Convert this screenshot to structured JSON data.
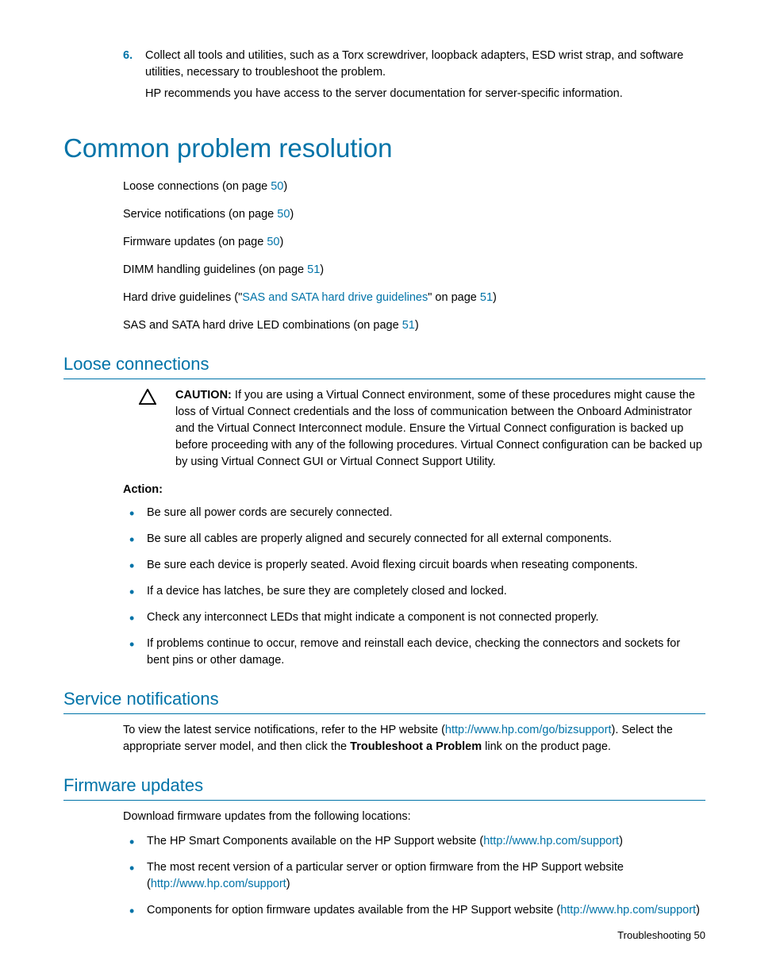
{
  "step6": {
    "num": "6.",
    "p1": "Collect all tools and utilities, such as a Torx screwdriver, loopback adapters, ESD wrist strap, and software utilities, necessary to troubleshoot the problem.",
    "p2": "HP recommends you have access to the server documentation for server-specific information."
  },
  "h1": "Common problem resolution",
  "toc": {
    "l1a": "Loose connections (on page ",
    "l1p": "50",
    "l1b": ")",
    "l2a": "Service notifications (on page ",
    "l2p": "50",
    "l2b": ")",
    "l3a": "Firmware updates (on page ",
    "l3p": "50",
    "l3b": ")",
    "l4a": "DIMM handling guidelines (on page ",
    "l4p": "51",
    "l4b": ")",
    "l5a": "Hard drive guidelines (\"",
    "l5link": "SAS and SATA hard drive guidelines",
    "l5b": "\" on page ",
    "l5p": "51",
    "l5c": ")",
    "l6a": "SAS and SATA hard drive LED combinations (on page ",
    "l6p": "51",
    "l6b": ")"
  },
  "loose": {
    "heading": "Loose connections",
    "caution_label": "CAUTION:",
    "caution_text": "   If you are using a Virtual Connect environment, some of these procedures might cause the loss of Virtual Connect credentials and the loss of communication between the Onboard Administrator and the Virtual Connect Interconnect module. Ensure the Virtual Connect configuration is backed up before proceeding with any of the following procedures. Virtual Connect configuration can be backed up by using Virtual Connect GUI or Virtual Connect Support Utility.",
    "action_label": "Action",
    "action_colon": ":",
    "b1": "Be sure all power cords are securely connected.",
    "b2": "Be sure all cables are properly aligned and securely connected for all external components.",
    "b3": "Be sure each device is properly seated. Avoid flexing circuit boards when reseating components.",
    "b4": "If a device has latches, be sure they are completely closed and locked.",
    "b5": "Check any interconnect LEDs that might indicate a component is not connected properly.",
    "b6": "If problems continue to occur, remove and reinstall each device, checking the connectors and sockets for bent pins or other damage."
  },
  "service": {
    "heading": "Service notifications",
    "p_a": "To view the latest service notifications, refer to the HP website (",
    "link": "http://www.hp.com/go/bizsupport",
    "p_b": "). Select the appropriate server model, and then click the ",
    "bold": "Troubleshoot a Problem",
    "p_c": " link on the product page."
  },
  "firmware": {
    "heading": "Firmware updates",
    "intro": "Download firmware updates from the following locations:",
    "b1a": "The HP Smart Components available on the HP Support website (",
    "b1link": "http://www.hp.com/support",
    "b1b": ")",
    "b2a": "The most recent version of a particular server or option firmware from the HP Support website (",
    "b2link": "http://www.hp.com/support",
    "b2b": ")",
    "b3a": "Components for option firmware updates available from the HP Support website (",
    "b3link": "http://www.hp.com/support",
    "b3b": ")"
  },
  "footer": {
    "text": "Troubleshooting   50"
  }
}
